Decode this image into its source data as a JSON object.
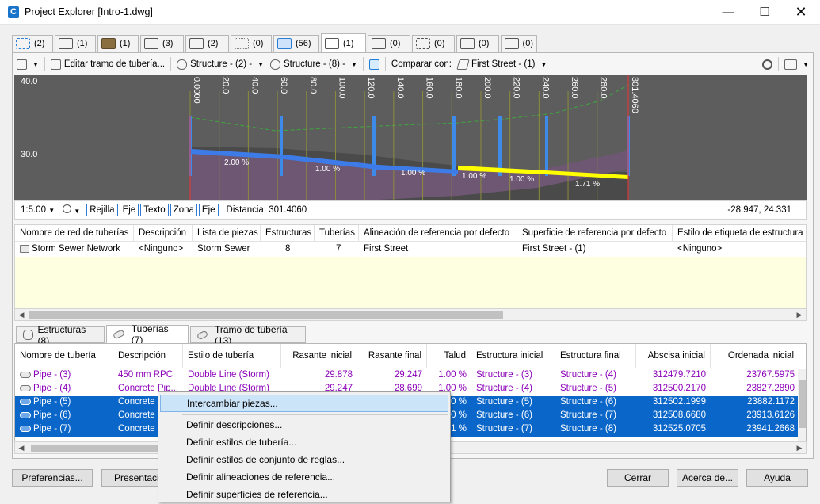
{
  "window": {
    "title": "Project Explorer [Intro-1.dwg]",
    "app_icon_letter": "C"
  },
  "top_tabs": [
    {
      "count": "(2)"
    },
    {
      "count": "(1)"
    },
    {
      "count": "(1)"
    },
    {
      "count": "(3)"
    },
    {
      "count": "(2)"
    },
    {
      "count": "(0)"
    },
    {
      "count": "(56)"
    },
    {
      "count": "(1)"
    },
    {
      "count": "(0)"
    },
    {
      "count": "(0)"
    },
    {
      "count": "(0)"
    },
    {
      "count": "(0)"
    }
  ],
  "toolbar": {
    "edit_label": "Editar tramo de tubería...",
    "structure_a": "Structure - (2) -",
    "structure_b": "Structure - (8) -",
    "compare_label": "Comparar con:",
    "compare_value": "First Street - (1)"
  },
  "profile": {
    "y_labels": [
      "40.0",
      "30.0"
    ],
    "station_labels": [
      "0.0000",
      "20.0",
      "40.0",
      "60.0",
      "80.0",
      "100.0",
      "120.0",
      "140.0",
      "160.0",
      "180.0",
      "200.0",
      "220.0",
      "240.0",
      "260.0",
      "280.0",
      "301.4060"
    ],
    "slope_labels": [
      "2.00 %",
      "1.00 %",
      "1.00 %",
      "1.00 %",
      "1.00 %",
      "1.71 %"
    ]
  },
  "profile_footer": {
    "scale": "1:5.00",
    "toggles": [
      "Rejilla",
      "Eje",
      "Texto",
      "Zona",
      "Eje"
    ],
    "distance": "Distancia: 301.4060",
    "coords": "-28.947, 24.331"
  },
  "network_grid": {
    "headers": [
      "Nombre de red de tuberías",
      "Descripción",
      "Lista de piezas",
      "Estructuras",
      "Tuberías",
      "Alineación de referencia por defecto",
      "Superficie de referencia por defecto",
      "Estilo de etiqueta de estructura"
    ],
    "row": [
      "Storm Sewer Network",
      "<Ninguno>",
      "Storm Sewer",
      "8",
      "7",
      "First Street",
      "First Street - (1)",
      "<Ninguno>"
    ]
  },
  "bottom_tabs": [
    "Estructuras (8)",
    "Tuberías (7)",
    "Tramo de tubería (13)"
  ],
  "pipe_grid": {
    "headers": [
      "Nombre de tubería",
      "Descripción",
      "Estilo de tubería",
      "Rasante inicial",
      "Rasante final",
      "Talud",
      "Estructura inicial",
      "Estructura final",
      "Abscisa inicial",
      "Ordenada inicial"
    ],
    "rows": [
      {
        "name": "Pipe - (3)",
        "desc": "450 mm RPC",
        "style": "Double Line (Storm)",
        "ras_ini": "29.878",
        "ras_fin": "29.247",
        "talud": "1.00 %",
        "est_ini": "Structure - (3)",
        "est_fin": "Structure - (4)",
        "abs": "312479.7210",
        "ord": "23767.5975",
        "selected": false
      },
      {
        "name": "Pipe - (4)",
        "desc": "Concrete Pip...",
        "style": "Double Line (Storm)",
        "ras_ini": "29.247",
        "ras_fin": "28.699",
        "talud": "1.00 %",
        "est_ini": "Structure - (4)",
        "est_fin": "Structure - (5)",
        "abs": "312500.2170",
        "ord": "23827.2890",
        "selected": false
      },
      {
        "name": "Pipe - (5)",
        "desc": "Concrete",
        "style": "",
        "ras_ini": "",
        "ras_fin": "",
        "talud": "0 %",
        "est_ini": "Structure - (5)",
        "est_fin": "Structure - (6)",
        "abs": "312502.1999",
        "ord": "23882.1172",
        "selected": true
      },
      {
        "name": "Pipe - (6)",
        "desc": "Concrete",
        "style": "",
        "ras_ini": "",
        "ras_fin": "",
        "talud": "0 %",
        "est_ini": "Structure - (6)",
        "est_fin": "Structure - (7)",
        "abs": "312508.6680",
        "ord": "23913.6126",
        "selected": true
      },
      {
        "name": "Pipe - (7)",
        "desc": "Concrete",
        "style": "",
        "ras_ini": "",
        "ras_fin": "",
        "talud": "1 %",
        "est_ini": "Structure - (7)",
        "est_fin": "Structure - (8)",
        "abs": "312525.0705",
        "ord": "23941.2668",
        "selected": true
      }
    ]
  },
  "context_menu": [
    "Intercambiar piezas...",
    "Definir descripciones...",
    "Definir estilos de tubería...",
    "Definir estilos de conjunto de reglas...",
    "Definir alineaciones de referencia...",
    "Definir superficies de referencia..."
  ],
  "buttons": {
    "preferences": "Preferencias...",
    "presentation": "Presentació",
    "close": "Cerrar",
    "about": "Acerca de...",
    "help": "Ayuda"
  }
}
